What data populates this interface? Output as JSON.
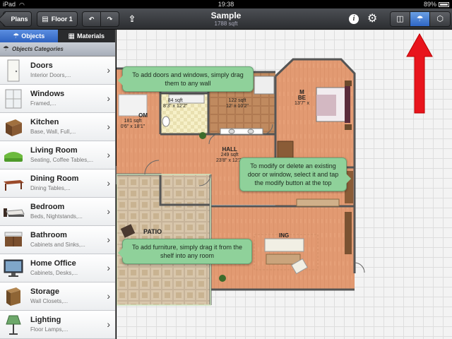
{
  "status": {
    "device": "iPad",
    "time": "19:38",
    "battery": "89%"
  },
  "toolbar": {
    "plans_label": "Plans",
    "floor_label": "Floor 1",
    "title": "Sample",
    "subtitle": "1788 sqft"
  },
  "sidebar": {
    "tabs": [
      {
        "label": "Objects"
      },
      {
        "label": "Materials"
      }
    ],
    "header": "Objects Categories",
    "categories": [
      {
        "name": "Doors",
        "desc": "Interior Doors,..."
      },
      {
        "name": "Windows",
        "desc": "Framed,..."
      },
      {
        "name": "Kitchen",
        "desc": "Base, Wall, Full,..."
      },
      {
        "name": "Living Room",
        "desc": "Seating, Coffee Tables,..."
      },
      {
        "name": "Dining Room",
        "desc": "Dining Tables,..."
      },
      {
        "name": "Bedroom",
        "desc": "Beds, Nightstands,..."
      },
      {
        "name": "Bathroom",
        "desc": "Cabinets and Sinks,..."
      },
      {
        "name": "Home Office",
        "desc": "Cabinets, Desks,..."
      },
      {
        "name": "Storage",
        "desc": "Wall Closets,..."
      },
      {
        "name": "Lighting",
        "desc": "Floor Lamps,..."
      }
    ]
  },
  "plan": {
    "rooms": {
      "bath1": {
        "area": "84 sqft",
        "dims": "8'3\" x 12'2\""
      },
      "bath2": {
        "area": "122 sqft",
        "dims": "12' x 10'2\""
      },
      "bedroom_left": {
        "name": "OM",
        "area": "181 sqft",
        "dims": "0'6\" x 18'1\""
      },
      "master": {
        "name_a": "M",
        "name_b": "BE",
        "name_c": "M",
        "dims": "13'7\" x"
      },
      "hall": {
        "name": "HALL",
        "area": "249 sqft",
        "dims": "23'8\" x 12'2\""
      },
      "patio": {
        "name": "PATIO"
      },
      "living": {
        "name": "ING"
      }
    },
    "tips": [
      "To add doors and windows, simply drag them to any wall",
      "To modify or delete an existing door or window, select it and tap the modify button at the top",
      "To add furniture, simply drag it from the shelf into any room"
    ]
  },
  "colors": {
    "indicator_arrow": "#e8141c",
    "tip_bg": "#8fd19a",
    "active_blue": "#2f66c5"
  }
}
